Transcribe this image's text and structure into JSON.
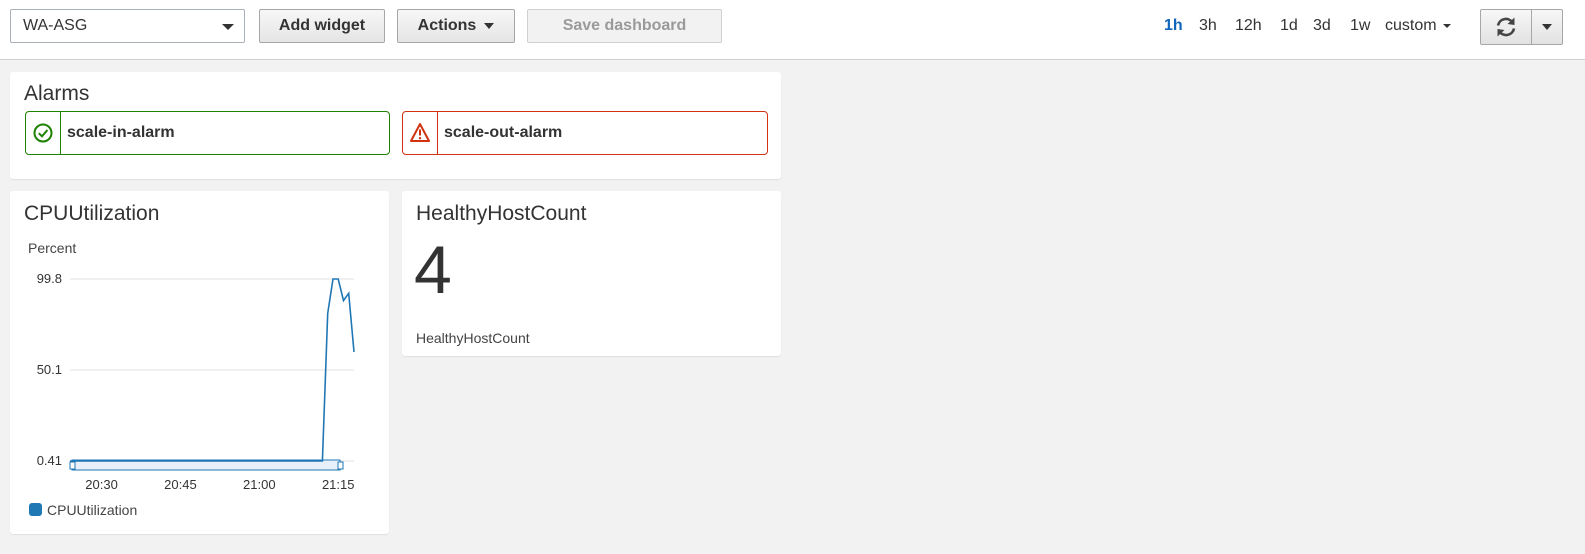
{
  "toolbar": {
    "dashboard_select": "WA-ASG",
    "add_widget": "Add widget",
    "actions": "Actions",
    "save_dashboard": "Save dashboard",
    "time_ranges": [
      {
        "label": "1h",
        "active": true
      },
      {
        "label": "3h",
        "active": false
      },
      {
        "label": "12h",
        "active": false
      },
      {
        "label": "1d",
        "active": false
      },
      {
        "label": "3d",
        "active": false
      },
      {
        "label": "1w",
        "active": false
      }
    ],
    "custom": "custom",
    "refresh_icon": "refresh-icon"
  },
  "alarms": {
    "title": "Alarms",
    "items": [
      {
        "name": "scale-in-alarm",
        "state": "ok",
        "icon": "check-circle-icon",
        "color": "#1d8102"
      },
      {
        "name": "scale-out-alarm",
        "state": "alarm",
        "icon": "warning-triangle-icon",
        "color": "#d13212"
      }
    ]
  },
  "cpu_widget": {
    "title": "CPUUtilization",
    "unit": "Percent",
    "legend": "CPUUtilization",
    "series_color": "#1f77b4"
  },
  "health_widget": {
    "title": "HealthyHostCount",
    "value": "4",
    "label": "HealthyHostCount"
  },
  "chart_data": {
    "type": "line",
    "title": "CPUUtilization",
    "ylabel": "Percent",
    "xlabel": "",
    "x_tick_labels": [
      "20:30",
      "20:45",
      "21:00",
      "21:15"
    ],
    "y_tick_labels": [
      "99.8",
      "50.1",
      "0.41"
    ],
    "ylim": [
      0.41,
      99.8
    ],
    "grid": true,
    "legend_position": "bottom-left",
    "series": [
      {
        "name": "CPUUtilization",
        "x": [
          "20:24",
          "20:27",
          "20:30",
          "20:33",
          "20:36",
          "20:39",
          "20:42",
          "20:45",
          "20:48",
          "20:51",
          "20:54",
          "20:57",
          "21:00",
          "21:03",
          "21:06",
          "21:09",
          "21:12",
          "21:13",
          "21:14",
          "21:15",
          "21:16",
          "21:17",
          "21:18"
        ],
        "y": [
          0.41,
          0.41,
          0.41,
          0.41,
          0.41,
          0.41,
          0.41,
          0.41,
          0.41,
          0.41,
          0.41,
          0.41,
          0.41,
          0.41,
          0.41,
          0.41,
          0.41,
          81,
          99.8,
          99.8,
          88,
          92,
          60
        ]
      }
    ]
  }
}
